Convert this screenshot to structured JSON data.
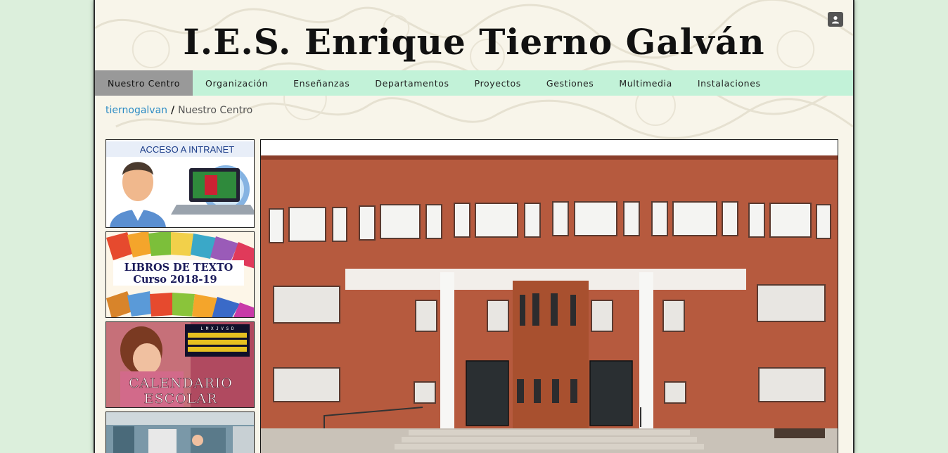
{
  "header": {
    "title": "I.E.S. Enrique Tierno Galván",
    "user_icon": "user-icon"
  },
  "nav": {
    "items": [
      {
        "label": "Nuestro Centro",
        "active": true
      },
      {
        "label": "Organización"
      },
      {
        "label": "Enseñanzas"
      },
      {
        "label": "Departamentos"
      },
      {
        "label": "Proyectos"
      },
      {
        "label": "Gestiones"
      },
      {
        "label": "Multimedia"
      },
      {
        "label": "Instalaciones"
      }
    ]
  },
  "breadcrumb": {
    "home": "tiernogalvan",
    "separator": "/",
    "current": "Nuestro Centro"
  },
  "sidebar": {
    "intranet": {
      "label": "ACCESO A INTRANET"
    },
    "books": {
      "line1": "LIBROS DE TEXTO",
      "line2": "Curso 2018-19"
    },
    "calendar": {
      "line1": "CALENDARIO",
      "line2": "ESCOLAR",
      "weekdays": "L M X J V S D"
    }
  },
  "colors": {
    "nav_bg": "#c2f2d8",
    "nav_active": "#999999",
    "link": "#2b8bc4",
    "body_bg": "#dcefdc",
    "brick": "#b9563a"
  }
}
